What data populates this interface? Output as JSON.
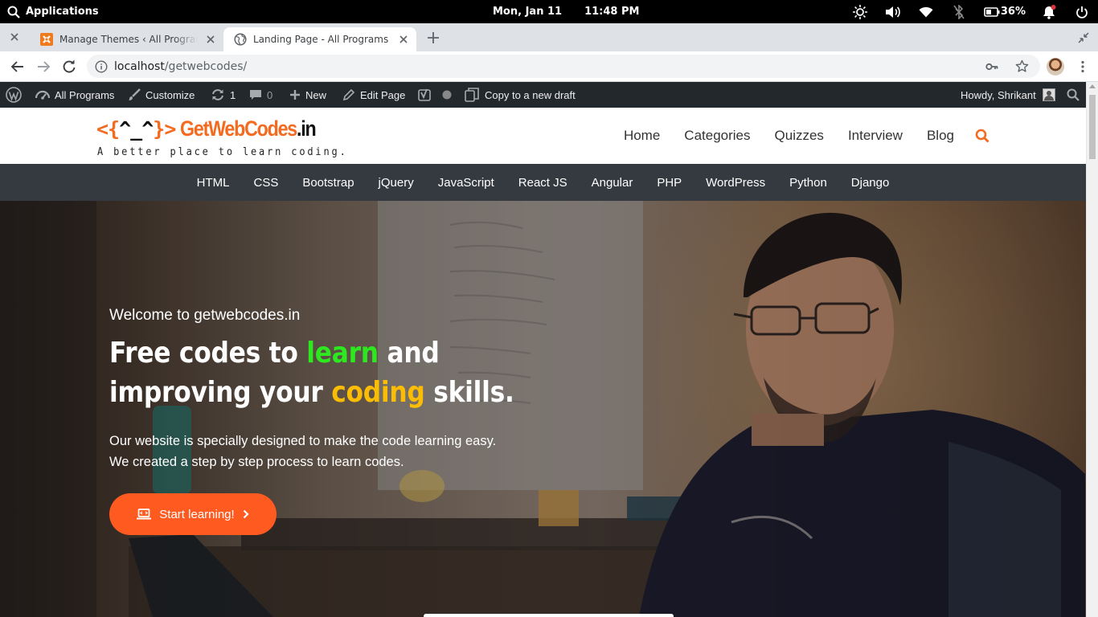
{
  "system_bar": {
    "applications": "Applications",
    "date": "Mon, Jan 11",
    "time": "11:48 PM",
    "battery": "36%"
  },
  "browser": {
    "tabs": [
      {
        "title": "Manage Themes ‹ All Programs — WordPress",
        "favicon": "xampp-icon",
        "active": false
      },
      {
        "title": "Landing Page - All Programs",
        "favicon": "globe-icon",
        "active": true
      }
    ],
    "url_host": "localhost",
    "url_path": "/getwebcodes/"
  },
  "admin_bar": {
    "site_name": "All Programs",
    "customize": "Customize",
    "updates_count": "1",
    "comments_count": "0",
    "new": "New",
    "edit_page": "Edit Page",
    "copy_draft": "Copy to a new draft",
    "howdy": "Howdy, Shrikant"
  },
  "site": {
    "logo": {
      "open": "<{",
      "face": "^_^",
      "close": "}>",
      "brand_a": "GetWebCodes",
      "brand_b": ".in",
      "tagline": "A better place to learn coding."
    },
    "main_nav": [
      "Home",
      "Categories",
      "Quizzes",
      "Interview",
      "Blog"
    ],
    "categories": [
      "HTML",
      "CSS",
      "Bootstrap",
      "jQuery",
      "JavaScript",
      "React JS",
      "Angular",
      "PHP",
      "WordPress",
      "Python",
      "Django"
    ],
    "hero": {
      "welcome": "Welcome to getwebcodes.in",
      "heading": {
        "p1": "Free codes to ",
        "hl1": "learn",
        "p2": " and",
        "p3": "improving your ",
        "hl2": "coding",
        "p4": " skills."
      },
      "subtext_line1": "Our website is specially designed to make the code learning easy.",
      "subtext_line2": "We created a step by step process to learn codes.",
      "cta": "Start learning!"
    }
  },
  "colors": {
    "brand_orange": "#f36b21",
    "cta": "#ff5a1f",
    "learn_green": "#2ee81f",
    "coding_yellow": "#fbbc05",
    "category_bar": "#343a40",
    "admin_bar": "#23282d"
  }
}
